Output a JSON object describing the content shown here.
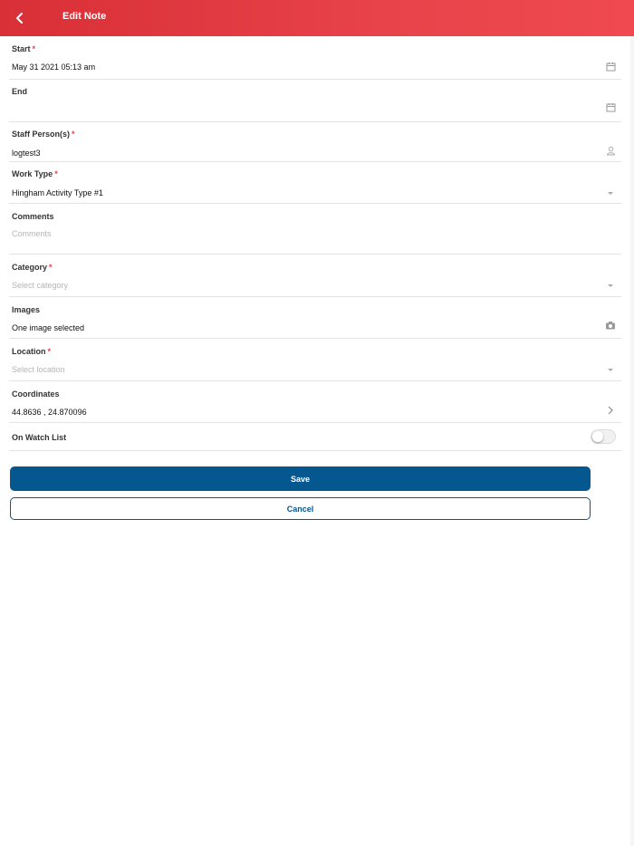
{
  "header": {
    "title": "Edit Note",
    "background": "#e8424a"
  },
  "fields": {
    "start": {
      "label": "Start",
      "required": "*",
      "value": "May 31 2021 05:13 am",
      "icon": "calendar-icon"
    },
    "end": {
      "label": "End",
      "value": "",
      "icon": "calendar-icon"
    },
    "staff": {
      "label": "Staff Person(s)",
      "required": "*",
      "value": "logtest3",
      "icon": "person-icon"
    },
    "work_type": {
      "label": "Work Type",
      "required": "*",
      "value": "Hingham Activity Type #1",
      "icon": "dropdown-arrow-icon"
    },
    "comments": {
      "label": "Comments",
      "placeholder": "Comments"
    },
    "category": {
      "label": "Category",
      "required": "*",
      "placeholder": "Select category",
      "icon": "dropdown-arrow-icon"
    },
    "images": {
      "label": "Images",
      "value": "One image selected",
      "icon": "camera-icon"
    },
    "location": {
      "label": "Location",
      "required": "*",
      "placeholder": "Select location",
      "icon": "dropdown-arrow-icon"
    },
    "coordinates": {
      "label": "Coordinates",
      "value": "44.8636 , 24.870096",
      "icon": "chevron-right-icon"
    },
    "watch_list": {
      "label": "On Watch List",
      "checked": false
    }
  },
  "actions": {
    "save_label": "Save",
    "cancel_label": "Cancel",
    "primary_color": "#04578f"
  }
}
